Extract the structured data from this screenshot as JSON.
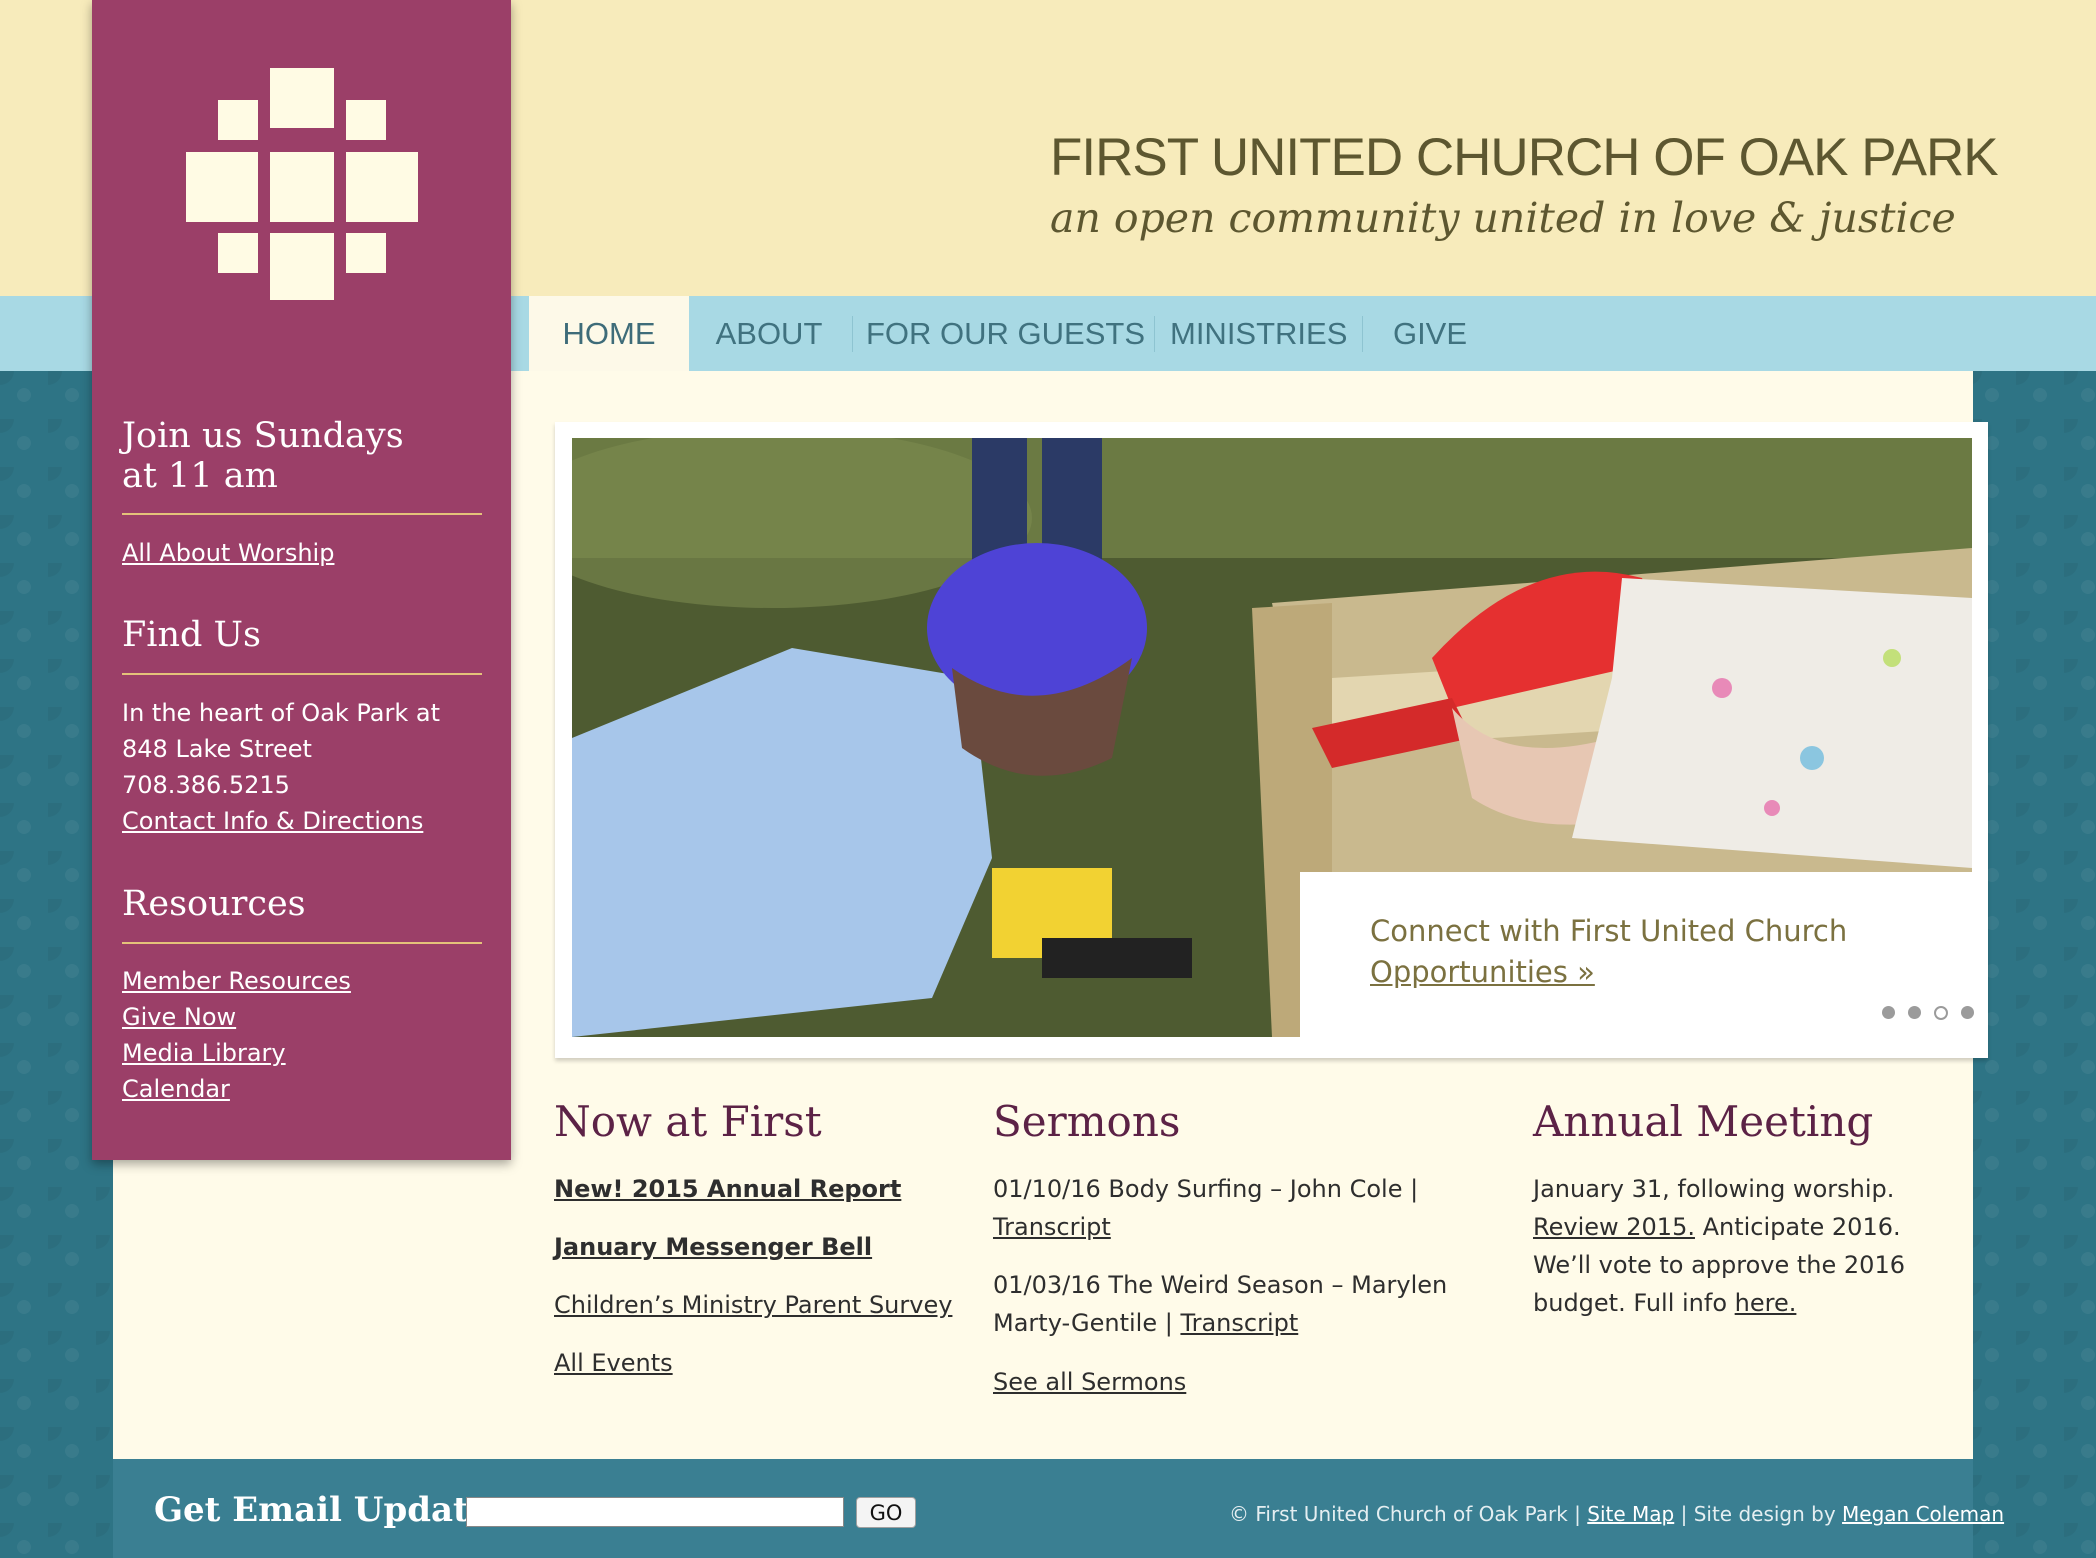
{
  "header": {
    "title": "FIRST UNITED CHURCH OF OAK PARK",
    "tagline": "an open community united in love & justice"
  },
  "logo": {
    "icon": "cross-mosaic-logo"
  },
  "nav": {
    "tabs": [
      {
        "label": "HOME",
        "active": true
      },
      {
        "label": "ABOUT"
      },
      {
        "label": "FOR OUR GUESTS"
      },
      {
        "label": "MINISTRIES"
      },
      {
        "label": "GIVE"
      }
    ]
  },
  "sidebar": {
    "worship": {
      "heading_line1": "Join us Sundays",
      "heading_line2": "at 11 am",
      "link": "All About Worship"
    },
    "find_us": {
      "heading": "Find Us",
      "line1": "In the heart of Oak Park at",
      "line2": "848 Lake Street",
      "phone": "708.386.5215",
      "link": "Contact Info & Directions"
    },
    "resources": {
      "heading": "Resources",
      "links": [
        "Member Resources",
        "Give Now",
        "Media Library",
        "Calendar"
      ]
    }
  },
  "slider": {
    "caption": "Connect with First United Church",
    "link": "Opportunities »",
    "dots": 4,
    "active_dot": 3
  },
  "now_at_first": {
    "heading": "Now at First",
    "links": [
      "New! 2015 Annual Report",
      "January Messenger Bell",
      "Children’s Ministry Parent Survey",
      "All Events"
    ]
  },
  "sermons": {
    "heading": "Sermons",
    "item1_line1": "01/10/16 Body Surfing – John Cole |",
    "item1_link": "Transcript",
    "item2_line1": "01/03/16 The Weird Season – Marylen",
    "item2_line2": "Marty-Gentile | ",
    "item2_link": "Transcript",
    "see_all": "See all Sermons"
  },
  "annual_meeting": {
    "heading": "Annual Meeting",
    "line1": "January 31, following worship.",
    "line2_link": "Review 2015.",
    "line2_rest": " Anticipate 2016.",
    "line3": "We’ll vote to approve the 2016",
    "line4_text": "budget. Full info ",
    "line4_link": "here."
  },
  "footer": {
    "email_label": "Get Email Updates:",
    "email_placeholder": "",
    "go_label": "GO",
    "copyright": "© First United Church of Oak Park | ",
    "sitemap": "Site Map",
    "design_text": " | Site design by ",
    "designer": "Megan Coleman"
  }
}
